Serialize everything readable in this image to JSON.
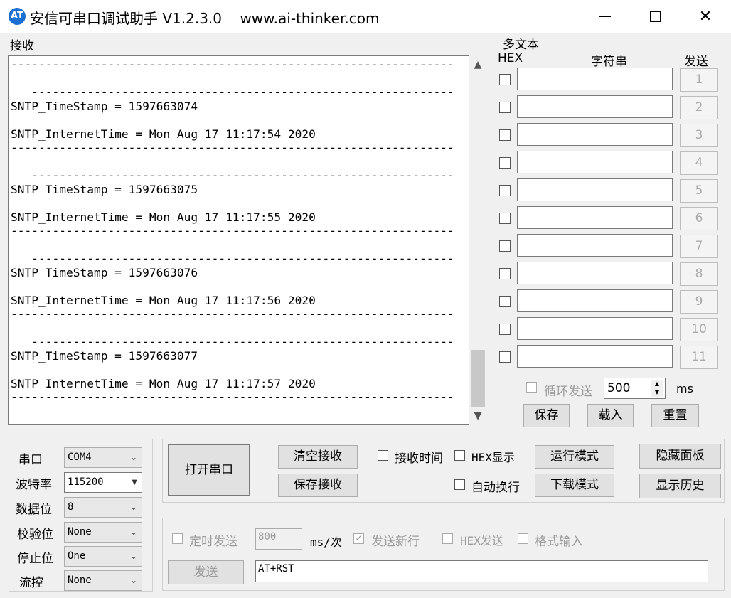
{
  "title": {
    "app_icon_text": "AT",
    "text": "安信可串口调试助手 V1.2.3.0    www.ai-thinker.com",
    "min": "—",
    "max": "☐",
    "close": "✕"
  },
  "receive": {
    "label": "接收",
    "text": "----------------------------------------------------------------\n\n   -------------------------------------------------------------\nSNTP_TimeStamp = 1597663074\n\nSNTP_InternetTime = Mon Aug 17 11:17:54 2020\n----------------------------------------------------------------\n\n   -------------------------------------------------------------\nSNTP_TimeStamp = 1597663075\n\nSNTP_InternetTime = Mon Aug 17 11:17:55 2020\n----------------------------------------------------------------\n\n   -------------------------------------------------------------\nSNTP_TimeStamp = 1597663076\n\nSNTP_InternetTime = Mon Aug 17 11:17:56 2020\n----------------------------------------------------------------\n\n   -------------------------------------------------------------\nSNTP_TimeStamp = 1597663077\n\nSNTP_InternetTime = Mon Aug 17 11:17:57 2020\n----------------------------------------------------------------",
    "scroll_up": "⌃",
    "scroll_down": "⌄"
  },
  "multi": {
    "label": "多文本",
    "hex_header": "HEX",
    "string_header": "字符串",
    "send_header": "发送",
    "rows": [
      "1",
      "2",
      "3",
      "4",
      "5",
      "6",
      "7",
      "8",
      "9",
      "10",
      "11"
    ],
    "loop_send": "循环发送",
    "interval": "500",
    "interval_unit": "ms",
    "save": "保存",
    "load": "载入",
    "reset": "重置"
  },
  "port": {
    "port_label": "串口",
    "port_value": "COM4",
    "baud_label": "波特率",
    "baud_value": "115200",
    "data_label": "数据位",
    "data_value": "8",
    "parity_label": "校验位",
    "parity_value": "None",
    "stop_label": "停止位",
    "stop_value": "One",
    "flow_label": "流控",
    "flow_value": "None"
  },
  "controls": {
    "open_port": "打开串口",
    "clear_recv": "清空接收",
    "save_recv": "保存接收",
    "recv_time": "接收时间",
    "hex_display": "HEX显示",
    "auto_newline": "自动换行",
    "run_mode": "运行模式",
    "download_mode": "下载模式",
    "hide_panel": "隐藏面板",
    "show_history": "显示历史"
  },
  "send": {
    "timed_send": "定时发送",
    "period": "800",
    "period_unit": "ms/次",
    "send_newline": "发送新行",
    "hex_send": "HEX发送",
    "format_input": "格式输入",
    "send_button": "发送",
    "input_value": "AT+RST"
  }
}
